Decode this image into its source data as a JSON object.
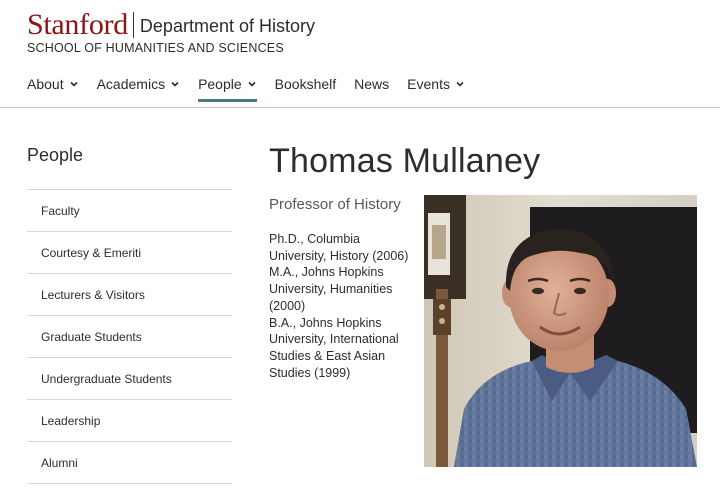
{
  "header": {
    "wordmark": "Stanford",
    "department": "Department of History",
    "school": "SCHOOL OF HUMANITIES AND SCIENCES"
  },
  "nav": {
    "items": [
      {
        "label": "About",
        "dropdown": true
      },
      {
        "label": "Academics",
        "dropdown": true
      },
      {
        "label": "People",
        "dropdown": true,
        "active": true
      },
      {
        "label": "Bookshelf",
        "dropdown": false
      },
      {
        "label": "News",
        "dropdown": false
      },
      {
        "label": "Events",
        "dropdown": true
      }
    ]
  },
  "sidebar": {
    "title": "People",
    "items": [
      {
        "label": "Faculty"
      },
      {
        "label": "Courtesy & Emeriti"
      },
      {
        "label": "Lecturers & Visitors"
      },
      {
        "label": "Graduate Students"
      },
      {
        "label": "Undergraduate Students"
      },
      {
        "label": "Leadership"
      },
      {
        "label": "Alumni"
      }
    ]
  },
  "profile": {
    "name": "Thomas Mullaney",
    "title": "Professor of History",
    "education": [
      "Ph.D., Columbia University, History (2006)",
      "M.A., Johns Hopkins University, Humanities (2000)",
      "B.A., Johns Hopkins University, International Studies & East Asian Studies (1999)"
    ],
    "photo_icon": "portrait-photo"
  },
  "colors": {
    "brand": "#8c1515",
    "nav_active_underline": "#4d7a7a",
    "text": "#2e2d29"
  }
}
